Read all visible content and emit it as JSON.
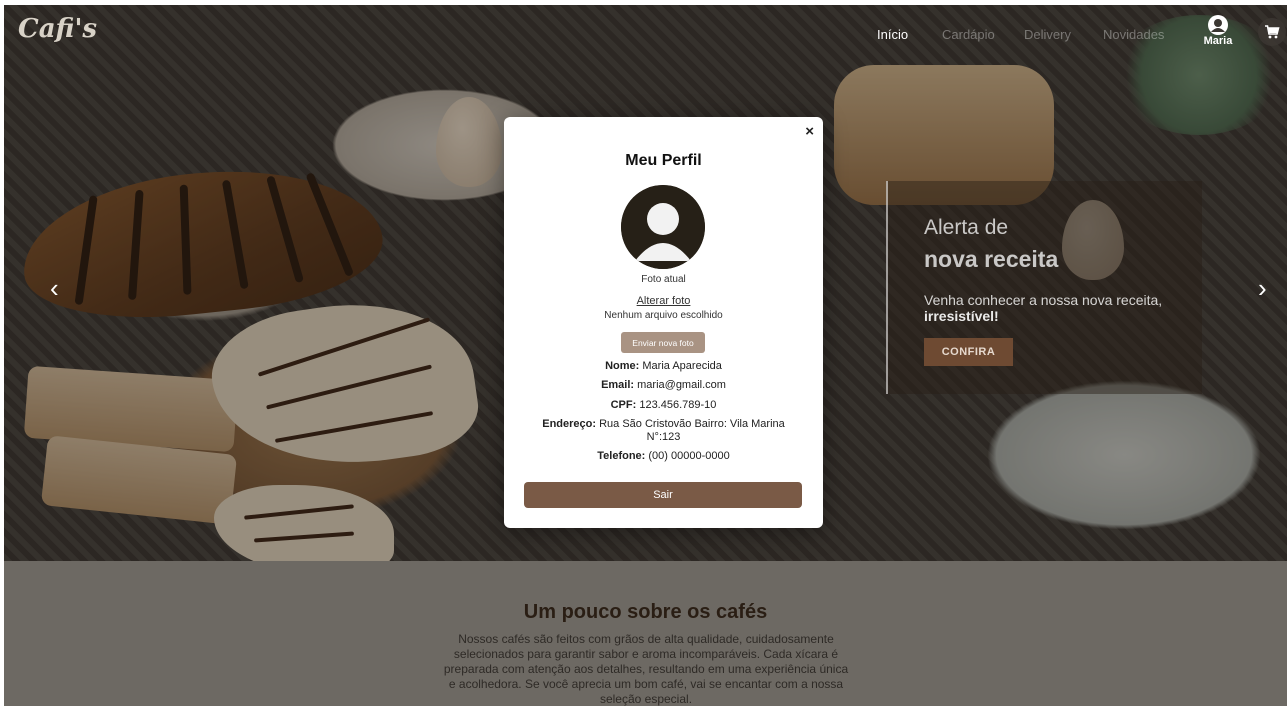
{
  "brand": {
    "logo_text": "Cafi's"
  },
  "nav": {
    "items": [
      {
        "label": "Início"
      },
      {
        "label": "Cardápio"
      },
      {
        "label": "Delivery"
      },
      {
        "label": "Novidades"
      }
    ],
    "user_name": "Maria",
    "cart_icon": "cart-icon",
    "user_icon": "user-icon"
  },
  "carousel": {
    "prev_symbol": "‹",
    "next_symbol": "›",
    "promo": {
      "title_line1": "Alerta de",
      "title_line2": "nova receita",
      "text": "Venha conhecer a nossa nova receita,",
      "text_bold": "irresistível!",
      "button_label": "CONFIRA"
    }
  },
  "about": {
    "title": "Um pouco sobre os cafés",
    "text": "Nossos cafés são feitos com grãos de alta qualidade, cuidadosamente selecionados para garantir sabor e aroma incomparáveis. Cada xícara é preparada com atenção aos detalhes, resultando em uma experiência única e acolhedora. Se você aprecia um bom café, vai se encantar com a nossa seleção especial."
  },
  "profile_modal": {
    "close_symbol": "×",
    "title": "Meu Perfil",
    "photo_label": "Foto atual",
    "change_photo_label": "Alterar foto",
    "no_file_label": "Nenhum arquivo escolhido",
    "send_photo_label": "Enviar nova foto",
    "fields": {
      "name_label": "Nome:",
      "name_value": "Maria Aparecida",
      "email_label": "Email:",
      "email_value": "maria@gmail.com",
      "cpf_label": "CPF:",
      "cpf_value": "123.456.789-10",
      "address_label": "Endereço:",
      "address_value": "Rua São Cristovão Bairro: Vila Marina N°:123",
      "phone_label": "Telefone:",
      "phone_value": "(00) 00000-0000"
    },
    "logout_label": "Sair"
  },
  "colors": {
    "accent_brown": "#7a5a46",
    "send_button": "#a99383",
    "promo_button": "#6e4a32"
  }
}
